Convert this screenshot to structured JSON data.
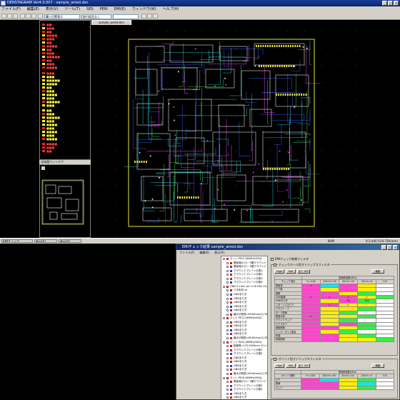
{
  "main_window": {
    "title": "DENSTAGRAM Ver4.0.007 - sample_wired.dsn",
    "menu": [
      "ファイル(F)",
      "編集(E)",
      "表示(V)",
      "ツール(T)",
      "SES",
      "PERI",
      "EMI(E)",
      "ウィンドウ(W)",
      "ヘルプ(H)"
    ],
    "toolbar_combo_1": "購入位置表示",
    "toolbar_combo_2": "取付部品なし",
    "document_tab": "sample_wired.dsn",
    "overview_title": "全体図ウィンドウ",
    "status_mode": "NUM",
    "status_coords": "X:3.440,Y:24.750(mm)",
    "taskbar_items": [
      "EMIチェック",
      "表示(V)",
      "表示(V)"
    ]
  },
  "emi_window": {
    "title": "EMIチェック結果 sample_wired.dsn",
    "menu": [
      "ファイル(F)",
      "編集(E)",
      "表示(V)"
    ],
    "tree_items": [
      {
        "label": "ネット PE12 [60MHz/50Ω]",
        "kind": "net"
      },
      {
        "label": "基板端から1~5層グラウンド",
        "kind": "item"
      },
      {
        "label": "基板端から1~5層グラウンド",
        "kind": "item"
      },
      {
        "label": "グラウンドプレーン分割1",
        "kind": "item"
      },
      {
        "label": "グラウンドプレーン分割2",
        "kind": "item"
      },
      {
        "label": "グラウンドプレーン分割3",
        "kind": "item"
      },
      {
        "label": "グラウンドプレーン分割4",
        "kind": "item"
      },
      {
        "label": "GND 0.1mm (d=1.00 DM=14.01)",
        "kind": "net"
      },
      {
        "label": "ベタ形状 xx",
        "kind": "item"
      },
      {
        "label": "GNDまたぎ",
        "kind": "item"
      },
      {
        "label": "GNDまたぎ",
        "kind": "item"
      },
      {
        "label": "GNDまたぎ",
        "kind": "item"
      },
      {
        "label": "GNDまたぎ",
        "kind": "item"
      },
      {
        "label": "GNDまたぎ",
        "kind": "item"
      },
      {
        "label": "最大分割長=69.60mm(2) DM=20.80",
        "kind": "item"
      },
      {
        "label": "ネット PE13 [60MHz/50Ω]",
        "kind": "net"
      },
      {
        "label": "GNDまたぎ",
        "kind": "item"
      },
      {
        "label": "GNDまたぎ",
        "kind": "item"
      },
      {
        "label": "GNDまたぎ",
        "kind": "item"
      },
      {
        "label": "GNDまたぎ",
        "kind": "item"
      },
      {
        "label": "最大分割長=69.60mm(2) DM=14.21",
        "kind": "item"
      },
      {
        "label": "ネット PA10 [60MHz/50Ω]",
        "kind": "net"
      },
      {
        "label": "配線長=175.0000mm ガンパルタ",
        "kind": "item"
      },
      {
        "label": "グラウンドプレーン分割1",
        "kind": "item"
      },
      {
        "label": "グラウンドプレーン分割2",
        "kind": "item"
      },
      {
        "label": "GNDまたぎ",
        "kind": "item"
      },
      {
        "label": "GNDまたぎ",
        "kind": "item"
      },
      {
        "label": "GNDまたぎ",
        "kind": "item"
      },
      {
        "label": "GNDまたぎ",
        "kind": "item"
      },
      {
        "label": "最大分割長=69.60mm(2) DM=10.03",
        "kind": "item"
      },
      {
        "label": "ネット PE16 [60MHz/50Ω]",
        "kind": "net"
      },
      {
        "label": "基板端から1~5層グラウンド",
        "kind": "item"
      },
      {
        "label": "グラウンドプレーン分割1",
        "kind": "item"
      },
      {
        "label": "グラウンドプレーン分割2",
        "kind": "item"
      },
      {
        "label": "GNDまたぎ",
        "kind": "item"
      },
      {
        "label": "GNDまたぎ",
        "kind": "item"
      }
    ],
    "filter_title": "EMIチェック結果フィルタ",
    "net_filter": {
      "group_label": "チェックルール別マトリックスフィルタ",
      "buttons": [
        "High",
        "Mid",
        "全て OFF"
      ],
      "edit_button": "編集",
      "freq_header": "配線周波数(MHz)",
      "columns": [
        "チェック項目",
        "f>=100",
        "100>f>=50",
        "50>f>=20",
        "20>f>=5",
        "f<5"
      ],
      "rows": [
        {
          "label": "配線長",
          "cells": [
            "p",
            "c",
            "p",
            "y",
            "w"
          ],
          "marks": [
            "✔",
            "",
            "",
            "",
            ""
          ]
        },
        {
          "label": "ビア数",
          "cells": [
            "p",
            "y",
            "p",
            "y",
            "w"
          ],
          "marks": [
            "",
            "",
            "",
            "",
            ""
          ]
        },
        {
          "label": "層数",
          "cells": [
            "p",
            "p",
            "y",
            "g",
            "w"
          ],
          "marks": [
            "",
            "",
            "",
            "",
            ""
          ]
        },
        {
          "label": "GND距離",
          "cells": [
            "p",
            "p",
            "p",
            "y",
            "g"
          ],
          "marks": [
            "✔",
            "✔",
            "✔",
            "✔",
            ""
          ]
        },
        {
          "label": "GNDまたぎ",
          "cells": [
            "p",
            "y",
            "p",
            "g",
            "w"
          ],
          "marks": [
            "",
            "",
            "54",
            "153",
            ""
          ]
        },
        {
          "label": "リターンパスビア",
          "cells": [
            "p",
            "p",
            "y",
            "y",
            "w"
          ],
          "marks": [
            "",
            "✔",
            "✔",
            "",
            ""
          ]
        },
        {
          "label": "クロストーク",
          "cells": [
            "p",
            "y",
            "y",
            "g",
            "w"
          ],
          "marks": [
            "",
            "",
            "",
            "",
            ""
          ]
        },
        {
          "label": "ガード配線",
          "cells": [
            "p",
            "y",
            "g",
            "w",
            "w"
          ],
          "marks": [
            "",
            "",
            "",
            "",
            ""
          ]
        },
        {
          "label": "配線分岐",
          "cells": [
            "p",
            "y",
            "y",
            "g",
            "w"
          ],
          "marks": [
            "✔",
            "",
            "",
            "",
            ""
          ]
        },
        {
          "label": "ラウンドラップ",
          "cells": [
            "p",
            "y",
            "g",
            "w",
            "w"
          ],
          "marks": [
            "",
            "",
            "",
            "",
            ""
          ]
        },
        {
          "label": "ビアスタブ",
          "cells": [
            "p",
            "y",
            "p",
            "g",
            "w"
          ],
          "marks": [
            "",
            "",
            "",
            "",
            ""
          ]
        },
        {
          "label": "差動配線",
          "cells": [
            "p",
            "p",
            "y",
            "g",
            "w"
          ],
          "marks": [
            "",
            "",
            "",
            "",
            ""
          ]
        },
        {
          "label": "インピーダンス整合",
          "cells": [
            "p",
            "y",
            "g",
            "w",
            "w"
          ],
          "marks": [
            "",
            "",
            "",
            "",
            ""
          ]
        },
        {
          "label": "終端",
          "cells": [
            "p",
            "p",
            "y",
            "g",
            "w"
          ],
          "marks": [
            "",
            "",
            "",
            "",
            ""
          ]
        },
        {
          "label": "電源配線",
          "cells": [
            "p",
            "p",
            "y",
            "y",
            "g"
          ],
          "marks": [
            "",
            "",
            "",
            "",
            ""
          ]
        }
      ]
    },
    "point_filter": {
      "group_label": "ポイント別マトリックスフィルタ",
      "buttons": [
        "High",
        "Mid",
        "全て OFF"
      ],
      "edit_button": "編集",
      "columns": [
        "ポイント種別",
        "f>=100",
        "100>f>=50",
        "50>f>=20",
        "20>f>=5",
        "f<5"
      ],
      "freq_header": "配線周波数(MHz)",
      "rows": [
        {
          "label": "ピア",
          "cells": [
            "p",
            "c",
            "y",
            "g",
            "w"
          ],
          "marks": [
            "",
            "",
            "",
            "",
            ""
          ]
        },
        {
          "label": "配線",
          "cells": [
            "p",
            "p",
            "y",
            "c",
            "w"
          ],
          "marks": [
            "",
            "",
            "",
            "",
            ""
          ]
        },
        {
          "label": "パッド",
          "cells": [
            "p",
            "p",
            "y",
            "g",
            "w"
          ],
          "marks": [
            "",
            "",
            "",
            "",
            ""
          ]
        }
      ]
    }
  },
  "colors": {
    "board_outline": "#ffff40",
    "trace_cyan": "#22dddd",
    "trace_blue": "#4060ff",
    "trace_magenta": "#ff40ff",
    "trace_green": "#40dd40",
    "component": "#e0e0e0"
  }
}
